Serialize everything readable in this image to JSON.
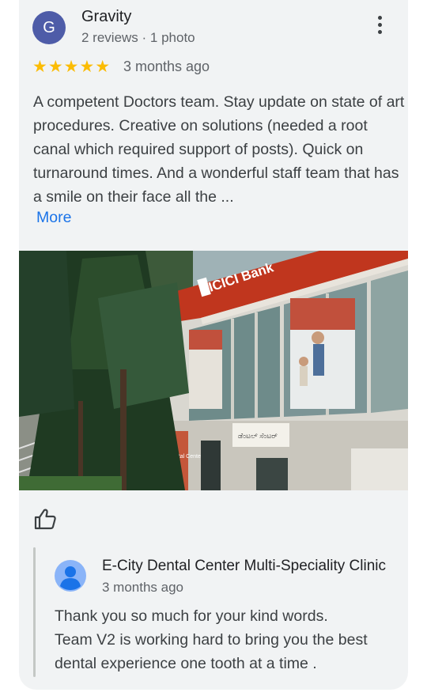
{
  "review": {
    "avatar_letter": "G",
    "avatar_color": "#4e5ca8",
    "reviewer_name": "Gravity",
    "reviewer_meta": "2 reviews · 1 photo",
    "rating": 5,
    "stars": "★★★★★",
    "date": "3 months ago",
    "text": "A competent Doctors team. Stay update on state of art procedures. Creative on solutions (needed a root canal which required support of posts). Quick on turnaround times. And a wonderful staff team that has a smile on their face all the ...",
    "more_label": "More"
  },
  "photo": {
    "sign_text": "ICICI Bank",
    "clinic_sign_text": "E-City Dental Center",
    "name_board_text": "ಡೆಂಟಲ್ ಸೆಂಟರ್"
  },
  "icons": {
    "menu": "more-vert-icon",
    "like": "thumb-up-icon",
    "reply_avatar": "person-icon"
  },
  "reply": {
    "owner_name": "E-City Dental Center Multi-Speciality Clinic",
    "date": "3 months ago",
    "lines": [
      "Thank you so much for your kind words.",
      "Team V2 is working hard to bring you the best",
      "dental experience one tooth at a time ."
    ]
  },
  "colors": {
    "card_background": "#f1f3f4",
    "star": "#fbbc04",
    "link": "#1a73e8"
  }
}
